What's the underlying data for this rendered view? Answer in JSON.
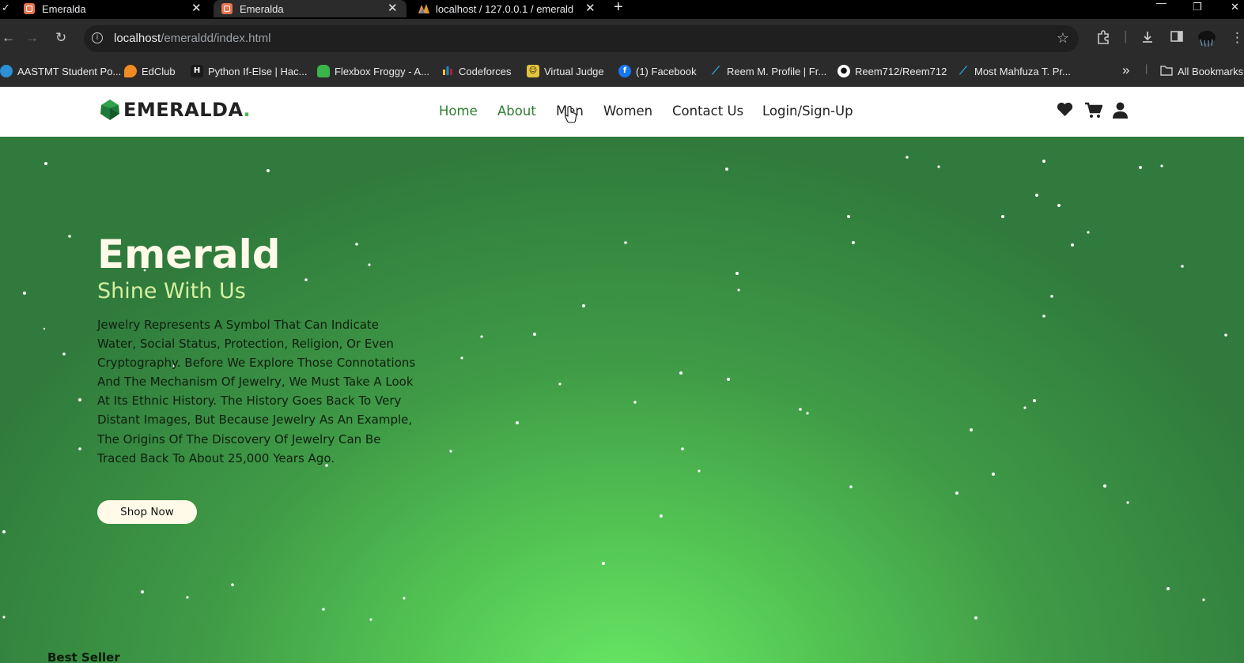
{
  "browser": {
    "tabs": [
      {
        "title": "Emeralda",
        "active": false,
        "icon": "xampp-icon"
      },
      {
        "title": "Emeralda",
        "active": true,
        "icon": "xampp-icon"
      },
      {
        "title": "localhost / 127.0.0.1 / emerald",
        "active": false,
        "icon": "phpmyadmin-icon"
      }
    ],
    "new_tab_glyph": "+",
    "url_host": "localhost",
    "url_path": "/emeraldd/index.html",
    "bookmarks": [
      {
        "label": "AASTMT Student Po...",
        "icon_color": "#2d8fd5"
      },
      {
        "label": "EdClub",
        "icon_color": "#f08a24"
      },
      {
        "label": "Python If-Else | Hac...",
        "icon_color": "#1a1a1a"
      },
      {
        "label": "Flexbox Froggy - A...",
        "icon_color": "#3ab54a"
      },
      {
        "label": "Codeforces",
        "icon_color": "#1f8acb"
      },
      {
        "label": "Virtual Judge",
        "icon_color": "#e5c33a"
      },
      {
        "label": "(1) Facebook",
        "icon_color": "#1877f2"
      },
      {
        "label": "Reem M. Profile | Fr...",
        "icon_color": "#0a7ec2"
      },
      {
        "label": "Reem712/Reem712",
        "icon_color": "#ffffff"
      },
      {
        "label": "Most Mahfuza T. Pr...",
        "icon_color": "#0a7ec2"
      }
    ],
    "bookmarks_overflow": "»",
    "all_bookmarks": "All Bookmarks"
  },
  "site": {
    "logo_text": "EMERALDA",
    "logo_dot": ".",
    "nav": [
      {
        "label": "Home",
        "style": "green"
      },
      {
        "label": "About",
        "style": "green"
      },
      {
        "label": "Men",
        "style": "dark"
      },
      {
        "label": "Women",
        "style": "dark"
      },
      {
        "label": "Contact Us",
        "style": "dark"
      },
      {
        "label": "Login/Sign-Up",
        "style": "dark"
      }
    ],
    "icons": [
      "heart-icon",
      "cart-icon",
      "user-icon"
    ]
  },
  "hero": {
    "title": "Emerald",
    "subtitle": "Shine With Us",
    "description": "Jewelry Represents A Symbol That Can Indicate Water, Social Status, Protection, Religion, Or Even Cryptography. Before We Explore Those Connotations And The Mechanism Of Jewelry, We Must Take A Look At Its Ethnic History. The History Goes Back To Very Distant Images, But Because Jewelry As An Example, The Origins Of The Discovery Of Jewelry Can Be Traced Back To About 25,000 Years Ago.",
    "button": "Shop Now"
  },
  "next_section": {
    "title": "Best Seller"
  },
  "colors": {
    "accent_green": "#2e7d32",
    "hero_center": "#69e864",
    "hero_edge": "#2f7a3c",
    "subtitle": "#d5f0a0",
    "button_bg": "#fffbe8"
  }
}
